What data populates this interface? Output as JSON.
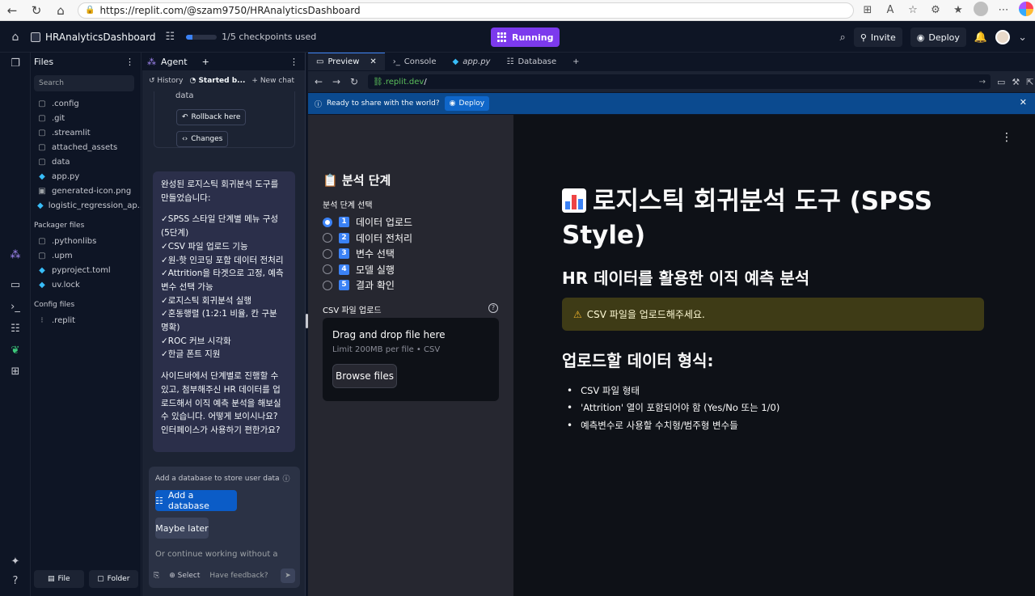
{
  "browser": {
    "url": "https://replit.com/@szam9750/HRAnalyticsDashboard"
  },
  "topbar": {
    "project_name": "HRAnalyticsDashboard",
    "checkpoints": "1/5 checkpoints used",
    "checkpoint_progress": 0.2,
    "status": "Running",
    "invite": "Invite",
    "deploy": "Deploy"
  },
  "files": {
    "title": "Files",
    "search_placeholder": "Search",
    "items": [
      ".config",
      ".git",
      ".streamlit",
      "attached_assets",
      "data",
      "app.py",
      "generated-icon.png",
      "logistic_regression_ap..."
    ],
    "packager_title": "Packager files",
    "packager_items": [
      ".pythonlibs",
      ".upm",
      "pyproject.toml",
      "uv.lock"
    ],
    "config_title": "Config files",
    "config_items": [
      ".replit"
    ],
    "add_file": "File",
    "add_folder": "Folder"
  },
  "agent": {
    "title": "Agent",
    "history": "History",
    "started": "Started b...",
    "new_chat": "New chat",
    "prev_text": "data",
    "rollback": "Rollback here",
    "changes": "Changes",
    "message": {
      "intro": "완성된 로지스틱 회귀분석 도구를 만들었습니다:",
      "items": [
        "✓SPSS 스타일 단계별 메뉴 구성 (5단계)",
        "✓CSV 파일 업로드 기능",
        "✓원-핫 인코딩 포함 데이터 전처리",
        "✓Attrition을 타겟으로 고정, 예측변수 선택 가능",
        "✓로지스틱 회귀분석 실행",
        "✓혼동행렬 (1:2:1 비율, 칸 구분 명확)",
        "✓ROC 커브 시각화",
        "✓한글 폰트 지원"
      ],
      "outro": "사이드바에서 단계별로 진행할 수 있고, 첨부해주신 HR 데이터를 업로드해서 이직 예측 분석을 해보실 수 있습니다. 어떻게 보이시나요? 인터페이스가 사용하기 편한가요?"
    },
    "db_prompt": "Add a database to store user data",
    "add_db": "Add a database",
    "maybe_later": "Maybe later",
    "continue_placeholder": "Or continue working without a",
    "select": "Select",
    "feedback": "Have feedback?"
  },
  "preview_tabs": [
    "Preview",
    "Console",
    "app.py",
    "Database"
  ],
  "preview": {
    "url_prefix": "/",
    "url_host": ".replit.dev",
    "share_text": "Ready to share with the world?",
    "share_deploy": "Deploy"
  },
  "streamlit": {
    "sidebar_title": "분석 단계",
    "radio_label": "분석 단계 선택",
    "steps": [
      {
        "num": "1",
        "label": "데이터 업로드",
        "selected": true
      },
      {
        "num": "2",
        "label": "데이터 전처리",
        "selected": false
      },
      {
        "num": "3",
        "label": "변수 선택",
        "selected": false
      },
      {
        "num": "4",
        "label": "모델 실행",
        "selected": false
      },
      {
        "num": "5",
        "label": "결과 확인",
        "selected": false
      }
    ],
    "upload_label": "CSV 파일 업로드",
    "drop_title": "Drag and drop file here",
    "drop_limit": "Limit 200MB per file • CSV",
    "browse": "Browse files",
    "title": "로지스틱 회귀분석 도구 (SPSS Style)",
    "subtitle": "HR 데이터를 활용한 이직 예측 분석",
    "warning": "CSV 파일을 업로드해주세요.",
    "format_title": "업로드할 데이터 형식:",
    "format_items": [
      "CSV 파일 형태",
      "'Attrition' 열이 포함되어야 함 (Yes/No 또는 1/0)",
      "예측변수로 사용할 수치형/범주형 변수들"
    ]
  }
}
